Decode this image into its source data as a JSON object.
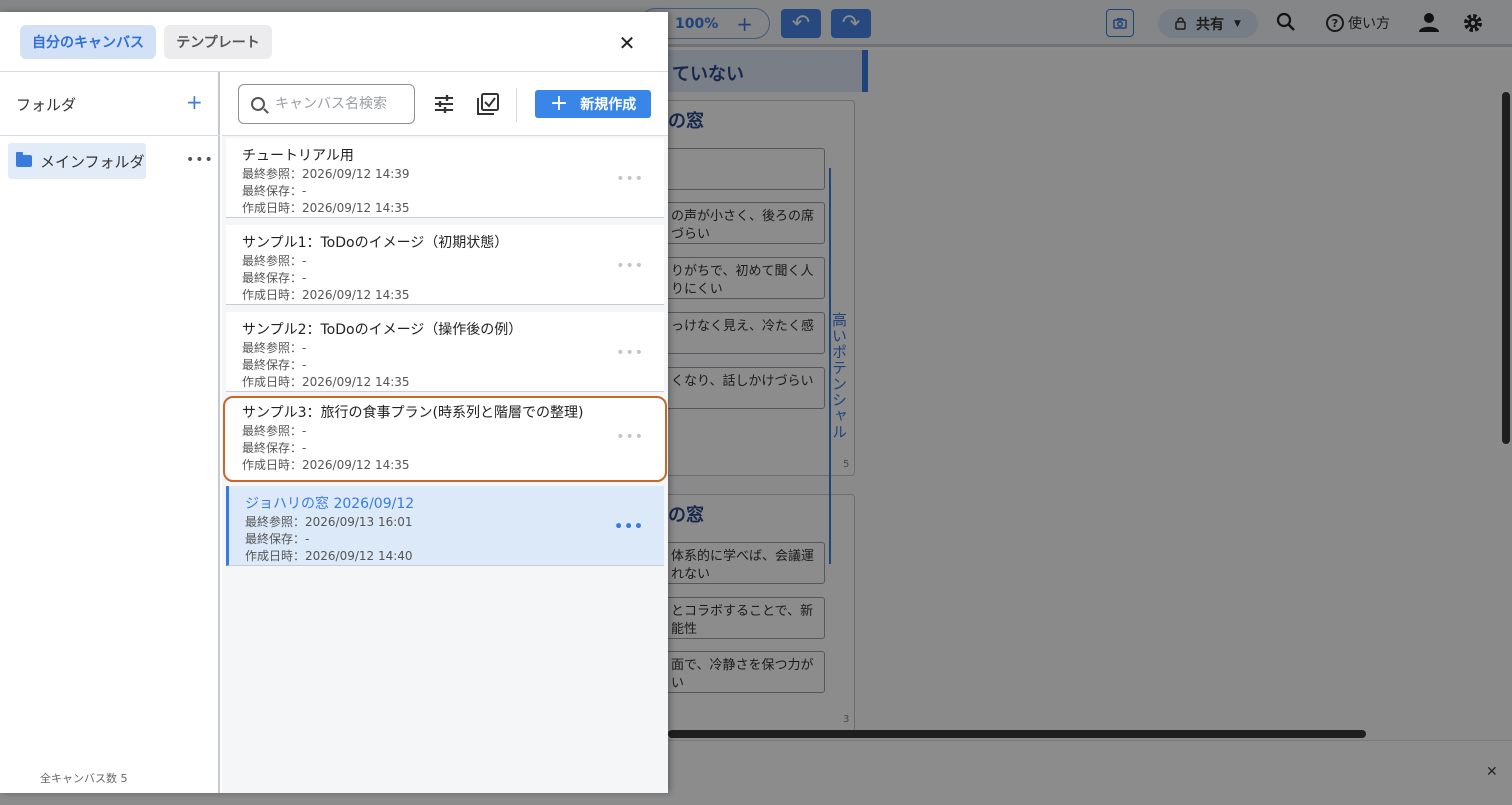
{
  "background": {
    "zoom": "100%",
    "share_label": "共有",
    "help_label": "使い方",
    "heading_partial": "ていない",
    "frame1_title": "の窓",
    "frame2_title": "の窓",
    "frame1_cards": [
      "",
      "の声が小さく、後ろの席\nづらい",
      "りがちで、初めて聞く人\nりにくい",
      "っけなく見え、冷たく感",
      "くなり、話しかけづらい"
    ],
    "frame2_cards": [
      "体系的に学べば、会議運\nれない",
      "とコラボすることで、新\n能性",
      "面で、冷静さを保つ力が\nい"
    ],
    "vertical_label": "高いポテンシャル",
    "page1": "5",
    "page2": "3"
  },
  "header": {
    "tabs": [
      {
        "label": "自分のキャンバス",
        "active": true
      },
      {
        "label": "テンプレート",
        "active": false
      }
    ],
    "close_symbol": "✕"
  },
  "sidebar": {
    "title": "フォルダ",
    "add_symbol": "+",
    "folders": [
      {
        "name": "メインフォルダ"
      }
    ],
    "more_symbol": "•••",
    "total": "全キャンバス数 5"
  },
  "toolbar": {
    "search_placeholder": "キャンバス名検索",
    "new_button": "新規作成",
    "new_plus": "+"
  },
  "canvases": [
    {
      "title": "チュートリアル用",
      "last_view": "最終参照：2026/09/12 14:39",
      "last_save": "最終保存：-",
      "created": "作成日時：2026/09/12 14:35",
      "state": "normal"
    },
    {
      "title": "サンプル1：ToDoのイメージ（初期状態）",
      "last_view": "最終参照：-",
      "last_save": "最終保存：-",
      "created": "作成日時：2026/09/12 14:35",
      "state": "normal"
    },
    {
      "title": "サンプル2：ToDoのイメージ（操作後の例）",
      "last_view": "最終参照：-",
      "last_save": "最終保存：-",
      "created": "作成日時：2026/09/12 14:35",
      "state": "normal"
    },
    {
      "title": "サンプル3：旅行の食事プラン(時系列と階層での整理)",
      "last_view": "最終参照：-",
      "last_save": "最終保存：-",
      "created": "作成日時：2026/09/12 14:35",
      "state": "highlighted"
    },
    {
      "title": "ジョハリの窓 2026/09/12",
      "last_view": "最終参照：2026/09/13 16:01",
      "last_save": "最終保存：-",
      "created": "作成日時：2026/09/12 14:40",
      "state": "selected"
    }
  ],
  "colors": {
    "accent": "#3a7be0",
    "highlight_border": "#c9662a",
    "selected_bg": "#dce9f9"
  }
}
